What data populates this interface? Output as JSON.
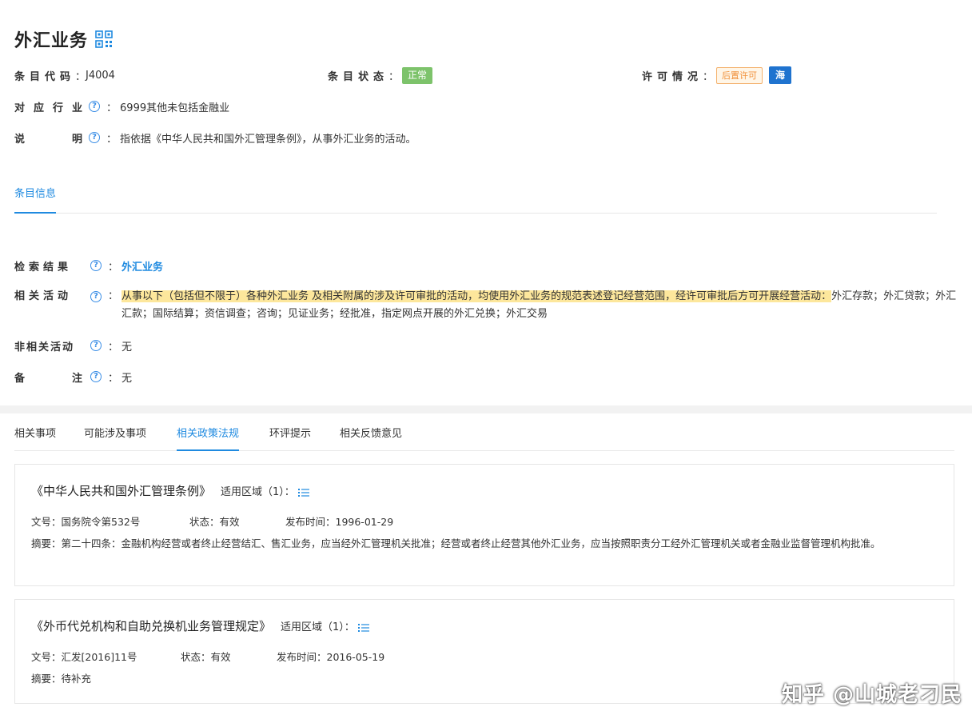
{
  "header": {
    "title": "外汇业务",
    "qr_icon": "qr-code-icon"
  },
  "meta": {
    "code_label": "条目代码",
    "code_value": "J4004",
    "status_label": "条目状态",
    "status_value": "正常",
    "status_color": "#7dc36b",
    "license_label": "许可情况",
    "license_value": "后置许可",
    "license_extra": "海",
    "license_extra_color": "#1f73cf"
  },
  "industry": {
    "label": "对应行业",
    "value": "6999其他未包括金融业"
  },
  "description": {
    "label_1": "说",
    "label_2": "明",
    "value": "指依据《中华人民共和国外汇管理条例》，从事外汇业务的活动。"
  },
  "section_tab": {
    "label": "条目信息"
  },
  "details": {
    "search_label": "检索结果",
    "search_value": "外汇业务",
    "related_label": "相关活动",
    "related_highlight": "从事以下（包括但不限于）各种外汇业务 及相关附属的涉及许可审批的活动，均使用外汇业务的规范表述登记经营范围，经许可审批后方可开展经营活动：",
    "related_rest": "外汇存款；外汇贷款；外汇汇款；国际结算；资信调查；咨询；见证业务；经批准，指定网点开展的外汇兑换；外汇交易",
    "nonrelated_label": "非相关活动",
    "nonrelated_value": "无",
    "remark_label_1": "备",
    "remark_label_2": "注",
    "remark_value": "无"
  },
  "tabs": [
    {
      "label": "相关事项"
    },
    {
      "label": "可能涉及事项"
    },
    {
      "label": "相关政策法规"
    },
    {
      "label": "环评提示"
    },
    {
      "label": "相关反馈意见"
    }
  ],
  "policies": [
    {
      "title": "《中华人民共和国外汇管理条例》",
      "area": "适用区域（1）：",
      "doc_no": "文号：国务院令第532号",
      "status": "状态：有效",
      "date": "发布时间：1996-01-29",
      "summary": "摘要：第二十四条：金融机构经营或者终止经营结汇、售汇业务，应当经外汇管理机关批准；经营或者终止经营其他外汇业务，应当按照职责分工经外汇管理机关或者金融业监督管理机构批准。"
    },
    {
      "title": "《外币代兑机构和自助兑换机业务管理规定》",
      "area": "适用区域（1）：",
      "doc_no": "文号：汇发[2016]11号",
      "status": "状态：有效",
      "date": "发布时间：2016-05-19",
      "summary": "摘要：待补充"
    }
  ],
  "watermark": "知乎 @山城老刁民",
  "accent_color": "#1f8ae0"
}
